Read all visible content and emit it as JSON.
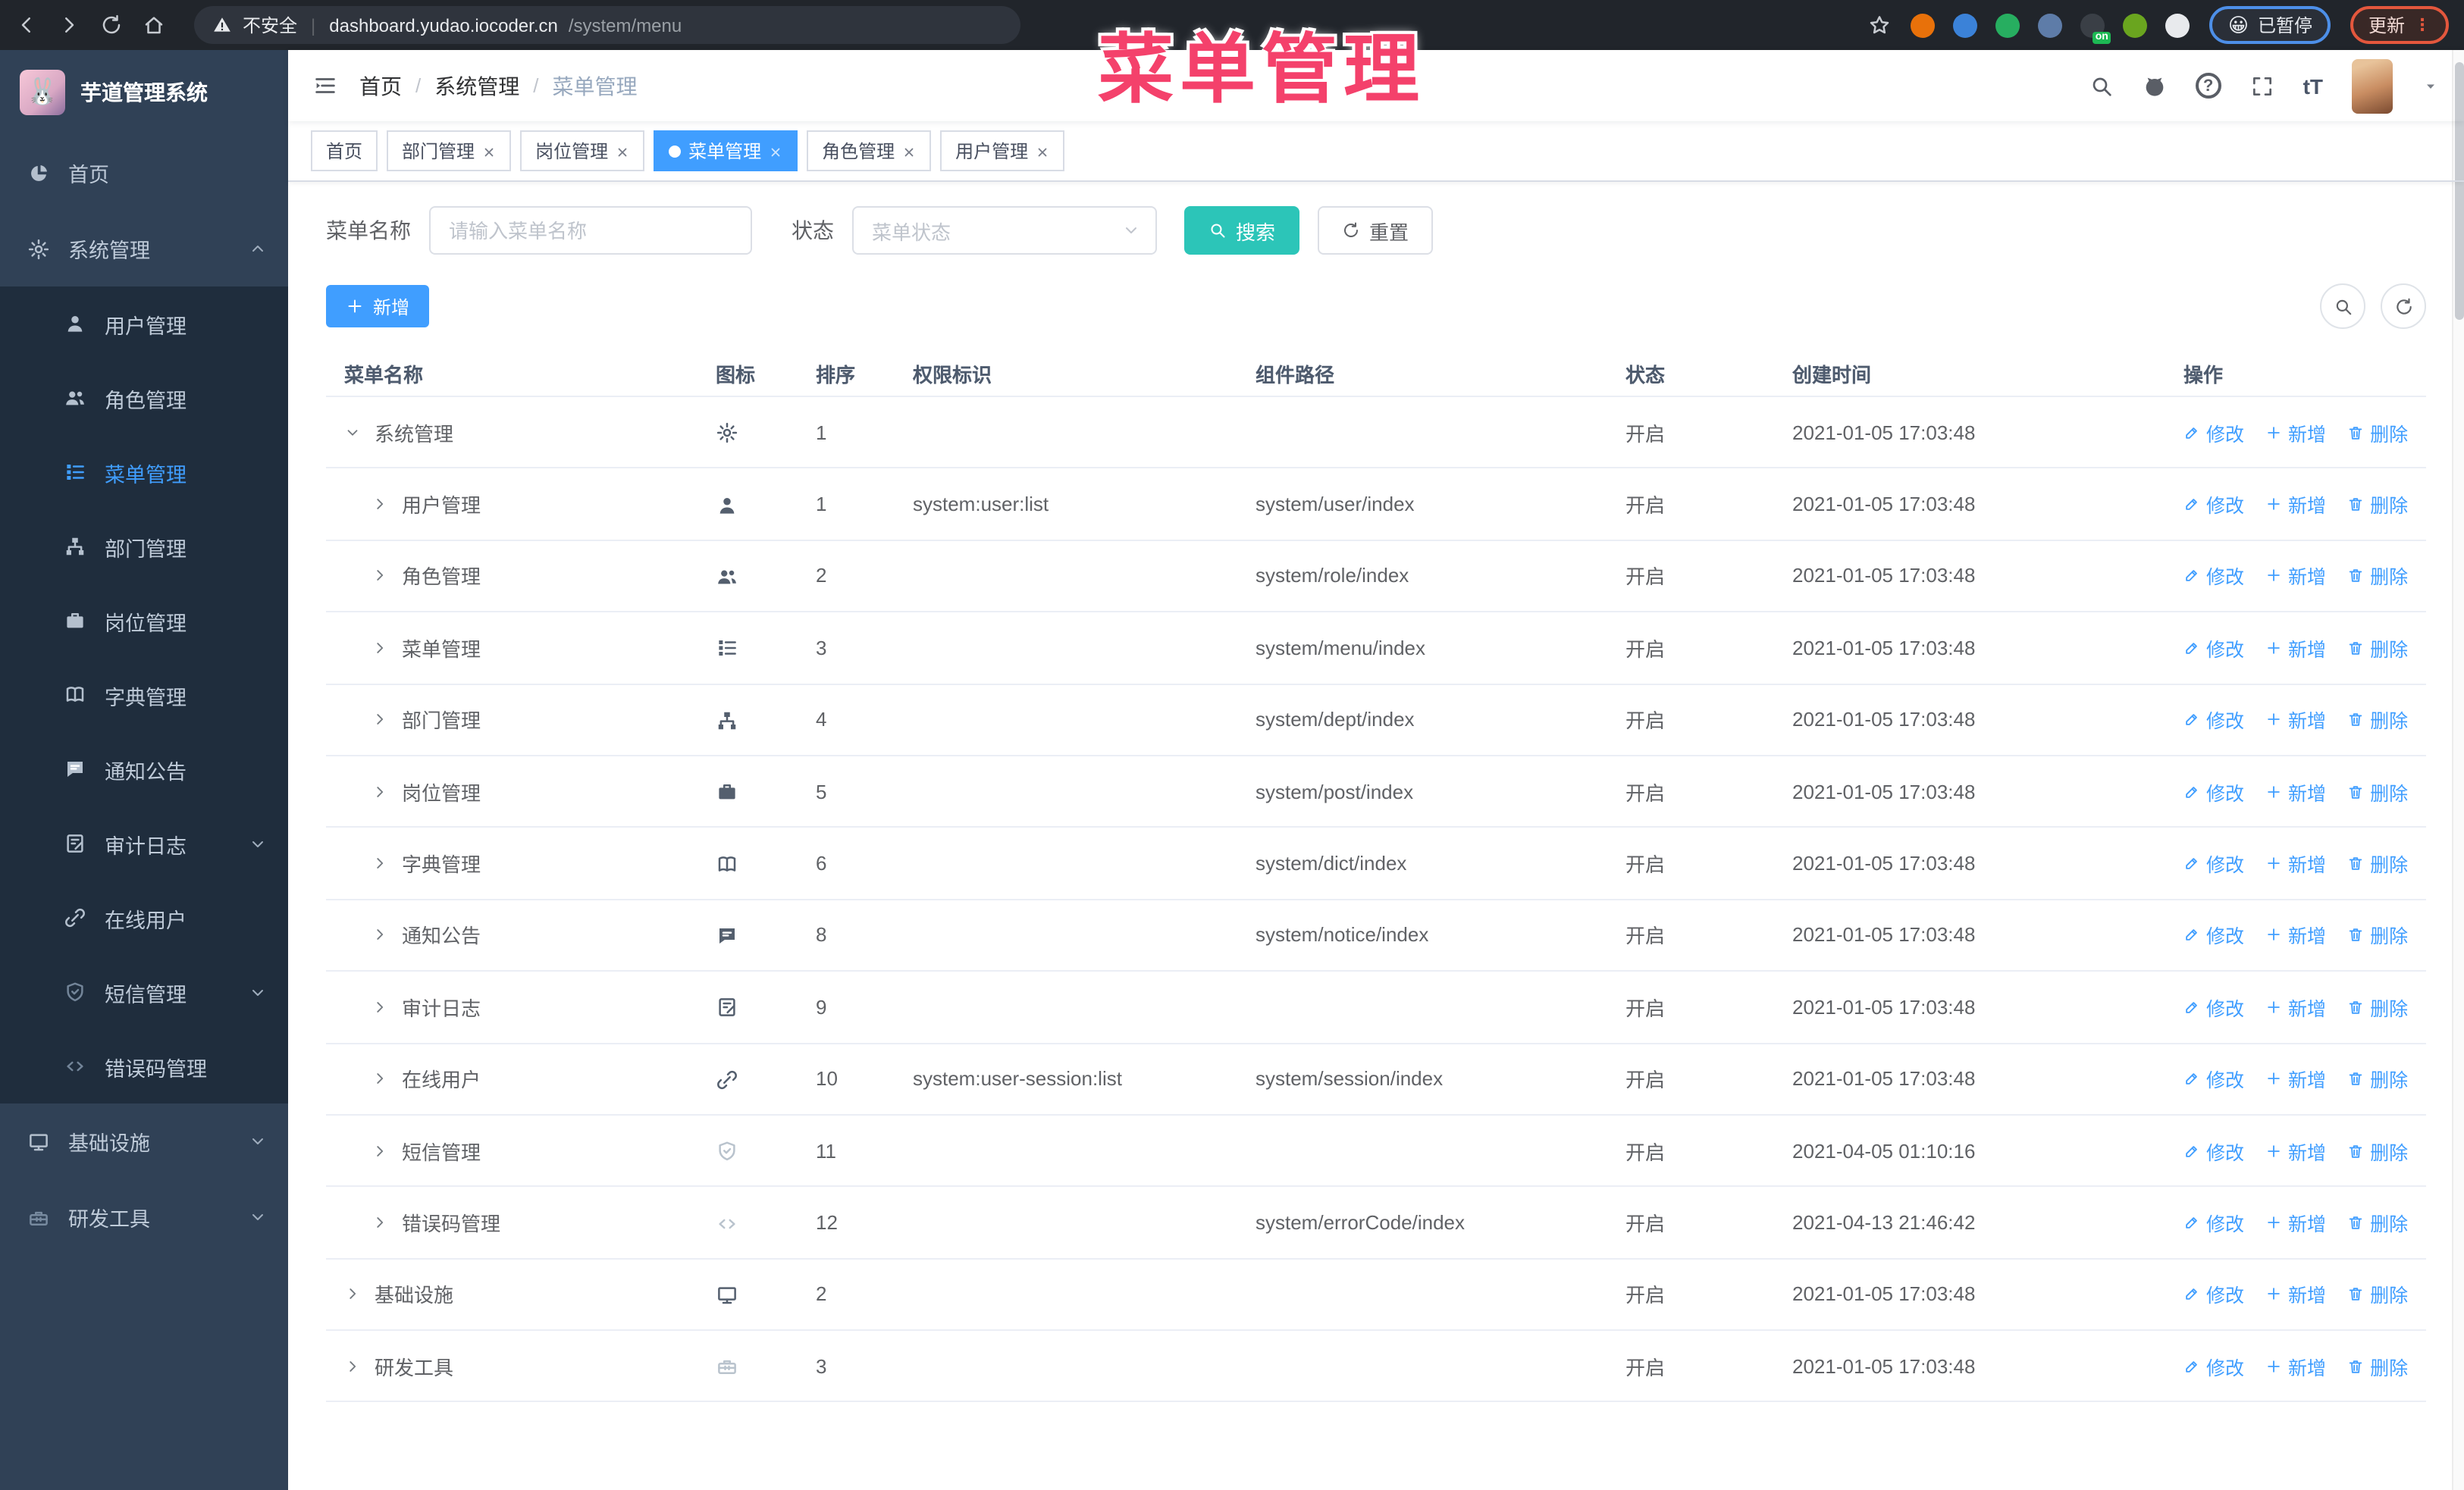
{
  "browser": {
    "security_label": "不安全",
    "url_host": "dashboard.yudao.iocoder.cn",
    "url_path": "/system/menu",
    "paused_badge": "已暂停",
    "paused_emoji": "😀",
    "update_button": "更新",
    "extensions": [
      {
        "name": "extension-orange",
        "color": "#e8710a"
      },
      {
        "name": "extension-blue-gem",
        "color": "#3b82d8"
      },
      {
        "name": "extension-green-check",
        "color": "#27ae60"
      },
      {
        "name": "extension-blue-grid",
        "color": "#5e7ca8"
      },
      {
        "name": "extension-dark-on",
        "color": "#3a3f46",
        "badge": true
      },
      {
        "name": "extension-green-search",
        "color": "#6aa51f"
      },
      {
        "name": "extension-puzzle",
        "color": "#e8eaed"
      }
    ]
  },
  "annotation": {
    "title": "菜单管理"
  },
  "sidebar": {
    "app_title": "芋道管理系统",
    "logo_emoji": "🐰",
    "items": [
      {
        "label": "首页",
        "icon": "dashboard",
        "level": 0
      },
      {
        "label": "系统管理",
        "icon": "gear",
        "level": 0,
        "chevron": "up"
      },
      {
        "label": "用户管理",
        "icon": "user",
        "level": 1
      },
      {
        "label": "角色管理",
        "icon": "users",
        "level": 1
      },
      {
        "label": "菜单管理",
        "icon": "menulist",
        "level": 1,
        "active": true
      },
      {
        "label": "部门管理",
        "icon": "org",
        "level": 1
      },
      {
        "label": "岗位管理",
        "icon": "briefcase",
        "level": 1
      },
      {
        "label": "字典管理",
        "icon": "book",
        "level": 1
      },
      {
        "label": "通知公告",
        "icon": "message",
        "level": 1
      },
      {
        "label": "审计日志",
        "icon": "log",
        "level": 1,
        "chevron": "down"
      },
      {
        "label": "在线用户",
        "icon": "link",
        "level": 1
      },
      {
        "label": "短信管理",
        "icon": "shield",
        "level": 1,
        "chevron": "down",
        "light": true
      },
      {
        "label": "错误码管理",
        "icon": "code",
        "level": 1,
        "light": true
      },
      {
        "label": "基础设施",
        "icon": "monitor",
        "level": 0,
        "chevron": "down"
      },
      {
        "label": "研发工具",
        "icon": "toolbox",
        "level": 0,
        "chevron": "down",
        "light": true
      }
    ]
  },
  "breadcrumb": {
    "items": [
      "首页",
      "系统管理",
      "菜单管理"
    ]
  },
  "tabs": [
    {
      "label": "首页",
      "closable": false,
      "active": false
    },
    {
      "label": "部门管理",
      "closable": true,
      "active": false
    },
    {
      "label": "岗位管理",
      "closable": true,
      "active": false
    },
    {
      "label": "菜单管理",
      "closable": true,
      "active": true
    },
    {
      "label": "角色管理",
      "closable": true,
      "active": false
    },
    {
      "label": "用户管理",
      "closable": true,
      "active": false
    }
  ],
  "filters": {
    "name_label": "菜单名称",
    "name_placeholder": "请输入菜单名称",
    "name_value": "",
    "status_label": "状态",
    "status_placeholder": "菜单状态",
    "search_label": "搜索",
    "reset_label": "重置"
  },
  "toolbar": {
    "add_label": "新增"
  },
  "table": {
    "columns": [
      "菜单名称",
      "图标",
      "排序",
      "权限标识",
      "组件路径",
      "状态",
      "创建时间",
      "操作"
    ],
    "action_labels": [
      "修改",
      "新增",
      "删除"
    ],
    "rows": [
      {
        "name": "系统管理",
        "level": 0,
        "expanded": true,
        "icon": "gear",
        "sort": "1",
        "perm": "",
        "path": "",
        "status": "开启",
        "time": "2021-01-05 17:03:48"
      },
      {
        "name": "用户管理",
        "level": 1,
        "icon": "user",
        "sort": "1",
        "perm": "system:user:list",
        "path": "system/user/index",
        "status": "开启",
        "time": "2021-01-05 17:03:48"
      },
      {
        "name": "角色管理",
        "level": 1,
        "icon": "users",
        "sort": "2",
        "perm": "",
        "path": "system/role/index",
        "status": "开启",
        "time": "2021-01-05 17:03:48"
      },
      {
        "name": "菜单管理",
        "level": 1,
        "icon": "menulist",
        "sort": "3",
        "perm": "",
        "path": "system/menu/index",
        "status": "开启",
        "time": "2021-01-05 17:03:48"
      },
      {
        "name": "部门管理",
        "level": 1,
        "icon": "org",
        "sort": "4",
        "perm": "",
        "path": "system/dept/index",
        "status": "开启",
        "time": "2021-01-05 17:03:48"
      },
      {
        "name": "岗位管理",
        "level": 1,
        "icon": "briefcase",
        "sort": "5",
        "perm": "",
        "path": "system/post/index",
        "status": "开启",
        "time": "2021-01-05 17:03:48"
      },
      {
        "name": "字典管理",
        "level": 1,
        "icon": "book",
        "sort": "6",
        "perm": "",
        "path": "system/dict/index",
        "status": "开启",
        "time": "2021-01-05 17:03:48"
      },
      {
        "name": "通知公告",
        "level": 1,
        "icon": "message",
        "sort": "8",
        "perm": "",
        "path": "system/notice/index",
        "status": "开启",
        "time": "2021-01-05 17:03:48"
      },
      {
        "name": "审计日志",
        "level": 1,
        "icon": "log",
        "sort": "9",
        "perm": "",
        "path": "",
        "status": "开启",
        "time": "2021-01-05 17:03:48"
      },
      {
        "name": "在线用户",
        "level": 1,
        "icon": "link",
        "sort": "10",
        "perm": "system:user-session:list",
        "path": "system/session/index",
        "status": "开启",
        "time": "2021-01-05 17:03:48"
      },
      {
        "name": "短信管理",
        "level": 1,
        "icon": "shield",
        "light": true,
        "sort": "11",
        "perm": "",
        "path": "",
        "status": "开启",
        "time": "2021-04-05 01:10:16"
      },
      {
        "name": "错误码管理",
        "level": 1,
        "icon": "code",
        "light": true,
        "sort": "12",
        "perm": "",
        "path": "system/errorCode/index",
        "status": "开启",
        "time": "2021-04-13 21:46:42"
      },
      {
        "name": "基础设施",
        "level": 0,
        "icon": "monitor",
        "sort": "2",
        "perm": "",
        "path": "",
        "status": "开启",
        "time": "2021-01-05 17:03:48"
      },
      {
        "name": "研发工具",
        "level": 0,
        "icon": "toolbox",
        "light": true,
        "sort": "3",
        "perm": "",
        "path": "",
        "status": "开启",
        "time": "2021-01-05 17:03:48"
      }
    ]
  },
  "colors": {
    "accent": "#409eff",
    "search_button": "#2cc5b8",
    "annotation": "#f4416b",
    "sidebar_bg": "#304156",
    "submenu_bg": "#1f2d3d",
    "active_text": "#409eff"
  }
}
